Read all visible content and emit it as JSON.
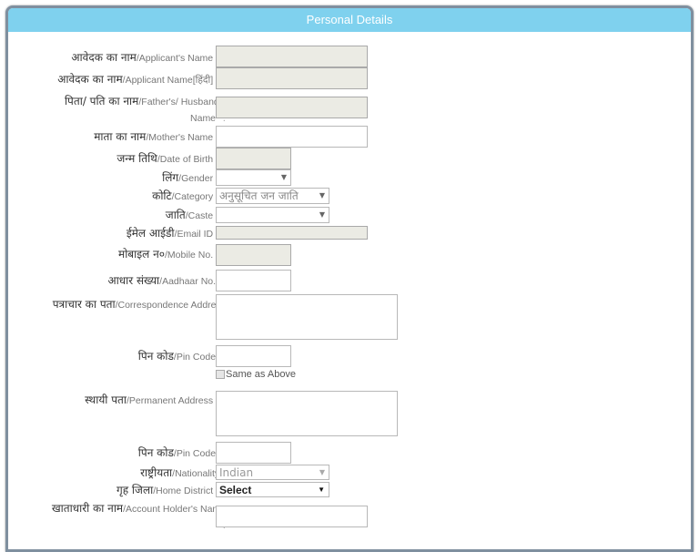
{
  "panel": {
    "title": "Personal Details"
  },
  "fields": {
    "applicant_name": {
      "hi": "आवेदक का नाम",
      "en": "/Applicant's Name *",
      "colon": ":",
      "value": ""
    },
    "applicant_name_hindi": {
      "hi": "आवेदक का नाम",
      "en": "/Applicant Name[हिंदी] *",
      "colon": ":",
      "value": ""
    },
    "father_husband_name": {
      "hi": "पिता/ पति का नाम",
      "en": "/Father's/ Husband's",
      "en2": "Name*",
      "colon": ":",
      "value": ""
    },
    "mother_name": {
      "hi": "माता का नाम",
      "en": "/Mother's Name *",
      "colon": ":",
      "value": ""
    },
    "dob": {
      "hi": "जन्म तिथि",
      "en": "/Date of Birth *",
      "colon": ":",
      "value": ""
    },
    "gender": {
      "hi": "लिंग",
      "en": "/Gender *",
      "colon": ":",
      "selected": ""
    },
    "category": {
      "hi": "कोटि",
      "en": "/Category *",
      "colon": ":",
      "selected": "अनुसूचित जन जाति"
    },
    "caste": {
      "hi": "जाति",
      "en": "/Caste *",
      "colon": ":",
      "selected": ""
    },
    "email": {
      "hi": "ईमेल आईडी",
      "en": "/Email ID *",
      "colon": ":",
      "value": ""
    },
    "mobile": {
      "hi": "मोबाइल न०",
      "en": "/Mobile No. *",
      "colon": ":",
      "value": ""
    },
    "aadhaar": {
      "hi": "आधार संख्या",
      "en": "/Aadhaar No.*",
      "colon": ":",
      "value": ""
    },
    "correspondence_address": {
      "hi": "पत्राचार का पता",
      "en": "/Correspondence Address",
      "en2": "*",
      "colon": ":",
      "value": ""
    },
    "pin_code_1": {
      "hi": "पिन कोड",
      "en": "/Pin Code*",
      "colon": ":",
      "value": ""
    },
    "same_as_above": {
      "label": "Same as Above",
      "checked": false
    },
    "permanent_address": {
      "hi": "स्थायी पता",
      "en": "/Permanent Address *",
      "colon": ":",
      "value": ""
    },
    "pin_code_2": {
      "hi": "पिन कोड",
      "en": "/Pin Code*",
      "colon": ":",
      "value": ""
    },
    "nationality": {
      "hi": "राष्ट्रीयता",
      "en": "/Nationality",
      "colon": ":",
      "selected": "Indian"
    },
    "home_district": {
      "hi": "गृह जिला",
      "en": "/Home District *",
      "colon": ":",
      "selected": "Select"
    },
    "account_holder_name": {
      "hi": "खाताधारी का नाम",
      "en": "/Account Holder's Name",
      "en2": "*",
      "colon": ":",
      "value": ""
    }
  },
  "icons": {
    "dropdown_arrow": "▼"
  }
}
